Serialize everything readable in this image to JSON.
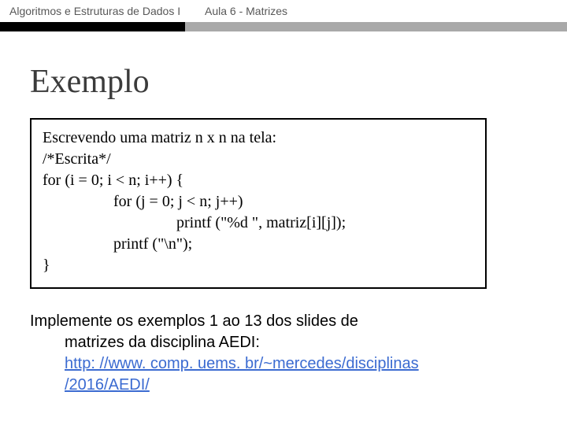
{
  "header": {
    "course": "Algoritmos e Estruturas de Dados I",
    "lesson": "Aula 6 -  Matrizes"
  },
  "title": "Exemplo",
  "codebox": {
    "line1": "Escrevendo uma matriz n x n na tela:",
    "line2": "/*Escrita*/",
    "line3": "for (i = 0; i < n; i++) {",
    "line4": "for (j = 0; j < n; j++)",
    "line5": "printf (\"%d \", matriz[i][j]);",
    "line6": "printf (\"\\n\");",
    "line7": "}"
  },
  "task": {
    "line1": "Implemente os exemplos 1 ao 13 dos slides de",
    "line2": "matrizes da disciplina AEDI:",
    "url1": "http: //www. comp. uems. br/~mercedes/disciplinas",
    "url2": "/2016/AEDI/"
  }
}
